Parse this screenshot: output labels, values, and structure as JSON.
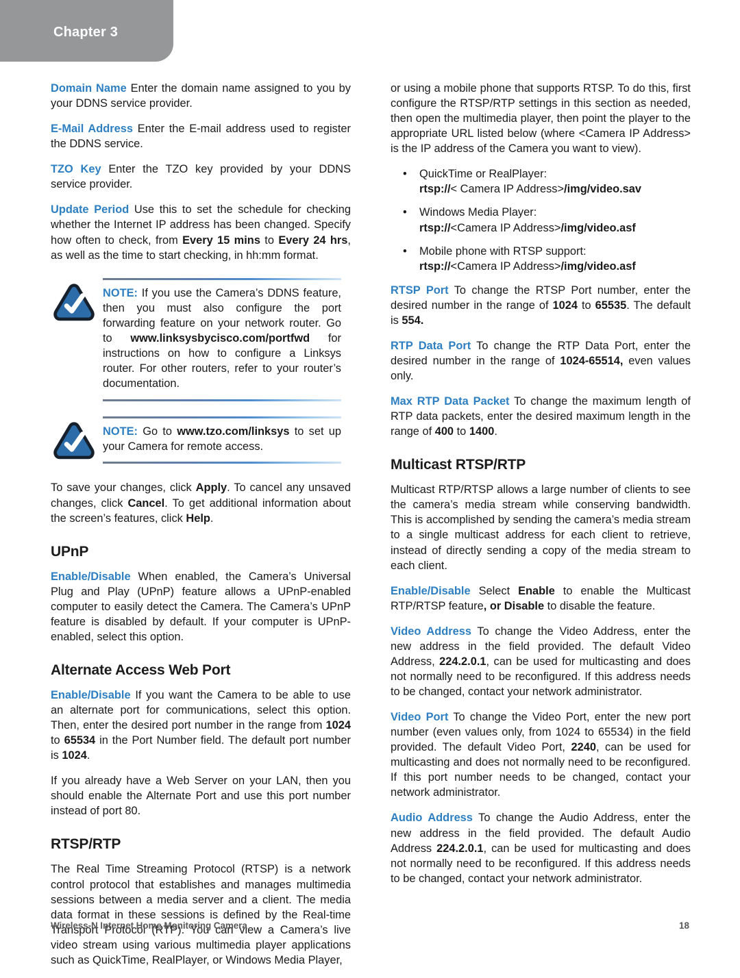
{
  "header": {
    "chapter_label": "Chapter 3",
    "band_color": "#959799"
  },
  "colors": {
    "accent_blue": "#2d7fc1",
    "note_icon_fill": "#2c6ca8",
    "note_icon_border": "#1d2b3a",
    "footer_gray": "#58595b"
  },
  "left_column": {
    "p_domain_name": {
      "term": "Domain Name",
      "text": "  Enter the domain name assigned to you by your DDNS service provider."
    },
    "p_email_address": {
      "term": "E-Mail Address",
      "text": "  Enter the E-mail address used to register the DDNS service."
    },
    "p_tzo_key": {
      "term": "TZO Key",
      "text": "  Enter the TZO key provided by your DDNS service provider."
    },
    "p_update_period": {
      "term": "Update Period",
      "t1": "  Use this to set the schedule for checking whether the Internet IP address has been changed. Specify how often to check, from ",
      "b1": "Every 15 mins",
      "t2": " to ",
      "b2": "Every 24 hrs",
      "t3": ", as well as the time to start checking, in hh:mm format."
    },
    "note_1": {
      "label": "NOTE:",
      "t1": " If you use the Camera’s DDNS feature, then you must also configure the port forwarding feature on your network router. Go to ",
      "b1": "www.linksysbycisco.com/portfwd",
      "t2": " for instructions on how to configure a Linksys router. For other routers, refer to your router’s documentation."
    },
    "note_2": {
      "label": "NOTE:",
      "t1": " Go to ",
      "b1": "www.tzo.com/linksys",
      "t2": " to set up your Camera for remote access."
    },
    "p_apply": {
      "t1": "To save your changes, click ",
      "b1": "Apply",
      "t2": ". To cancel any unsaved changes, click ",
      "b2": "Cancel",
      "t3": ". To get additional information about the screen’s features, click ",
      "b3": "Help",
      "t4": "."
    },
    "head_upnp": "UPnP",
    "p_upnp": {
      "term": "Enable/Disable",
      "text": "  When enabled, the Camera’s Universal Plug and Play (UPnP) feature allows a UPnP-enabled computer to easily detect the Camera. The Camera’s UPnP feature is disabled by default. If your computer is UPnP-enabled, select this option."
    },
    "head_alternate": "Alternate Access Web Port",
    "p_alternate_1": {
      "term": "Enable/Disable",
      "t1": "  If you want the Camera to be able to use an alternate port for communications, select this option. Then, enter the desired port number in the range from ",
      "b1": "1024",
      "t2": " to ",
      "b2": "65534",
      "t3": " in the Port Number field. The default port number is ",
      "b3": "1024",
      "t4": "."
    },
    "p_alternate_2": "If you already have a Web Server on your LAN, then you should enable the Alternate Port and use this port number instead of port 80.",
    "head_rtsp": "RTSP/RTP",
    "p_rtsp": "The Real Time Streaming Protocol (RTSP) is a network control protocol that establishes and manages multimedia sessions between a media server and a client. The media data format in these sessions is defined by the Real-time Transport Protocol (RTP). You can view a Camera’s live video stream using various multimedia player applications such as QuickTime, RealPlayer, or Windows Media Player,"
  },
  "right_column": {
    "p_intro": "or using a mobile phone that supports RTSP. To do this, first configure the RTSP/RTP settings in this section as needed, then open the multimedia player, then point the player to the appropriate URL listed below (where <Camera IP Address> is the IP address of the Camera you want to view).",
    "bullets": [
      {
        "label": "QuickTime or RealPlayer:",
        "scheme": "rtsp://",
        "placeholder": "< Camera IP Address>",
        "path": "/img/video.sav"
      },
      {
        "label": "Windows Media Player:",
        "scheme": "rtsp://",
        "placeholder": "<Camera IP Address>",
        "path": "/img/video.asf"
      },
      {
        "label": "Mobile phone with RTSP support:",
        "scheme": "rtsp://",
        "placeholder": "<Camera IP Address>",
        "path": "/img/video.asf"
      }
    ],
    "p_rtsp_port": {
      "term": "RTSP Port",
      "t1": "  To change the RTSP Port number, enter the desired number in the range of ",
      "b1": "1024",
      "t2": " to ",
      "b2": "65535",
      "t3": ". The default is ",
      "b3": "554.",
      "t4": ""
    },
    "p_rtp_data_port": {
      "term": "RTP Data Port",
      "t1": "  To change the RTP Data Port, enter the desired number in the range of ",
      "b1": "1024-65514,",
      "t2": " even values only."
    },
    "p_max_rtp": {
      "term": "Max RTP Data Packet",
      "t1": "  To change the maximum length of RTP data packets, enter the desired maximum length in the range of ",
      "b1": "400",
      "t2": " to ",
      "b2": "1400",
      "t3": "."
    },
    "head_multicast": "Multicast RTSP/RTP",
    "p_multicast": "Multicast RTP/RTSP allows a large number of clients to see the camera’s media stream while conserving bandwidth. This is accomplished by sending the camera’s media stream to a single multicast address for each client to retrieve, instead of directly sending a copy of the media stream to each client.",
    "p_enable_disable": {
      "term": "Enable/Disable",
      "t1": "  Select ",
      "b1": "Enable",
      "t2": " to enable the Multicast RTP/RTSP feature",
      "b2": ", or Disable",
      "t3": " to disable the feature."
    },
    "p_video_address": {
      "term": "Video Address",
      "t1": "  To change the Video Address, enter the new address in the field provided. The default Video Address, ",
      "b1": "224.2.0.1",
      "t2": ", can be used for multicasting and does not normally need to be reconfigured. If this address needs to be changed, contact your network administrator."
    },
    "p_video_port": {
      "term": "Video Port",
      "t1": "  To change the Video Port, enter the new port number  (even values only, from 1024 to 65534) in the field provided. The default Video Port, ",
      "b1": "2240",
      "t2": ", can be used for multicasting and does not normally need to be reconfigured. If this port number needs to be changed, contact your network administrator."
    },
    "p_audio_address": {
      "term": "Audio Address",
      "t1": "  To change the Audio Address, enter the new address in the field provided. The default Audio Address ",
      "b1": "224.2.0.1",
      "t2": ", can be used for multicasting and does not normally need to be reconfigured. If this address needs to be changed, contact your network administrator."
    }
  },
  "footer": {
    "title": "Wireless-N Internet Home Monitoring Camera",
    "page_number": "18"
  },
  "bullet_glyph": "•"
}
